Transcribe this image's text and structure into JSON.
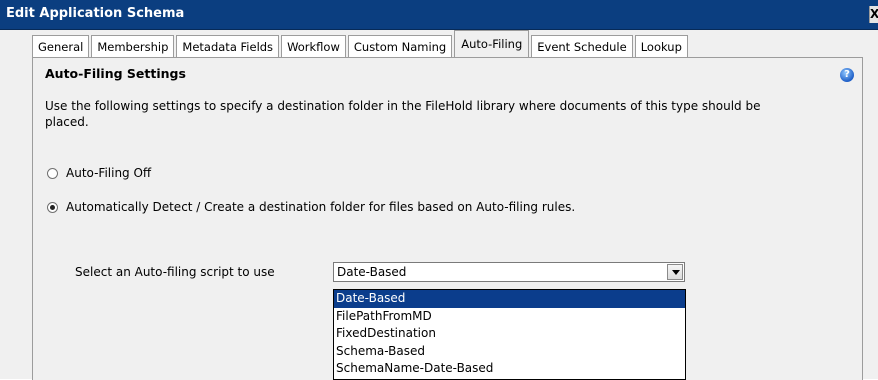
{
  "window": {
    "title": "Edit Application Schema",
    "close_label": "X"
  },
  "tabs": [
    {
      "label": "General",
      "active": false
    },
    {
      "label": "Membership",
      "active": false
    },
    {
      "label": "Metadata Fields",
      "active": false
    },
    {
      "label": "Workflow",
      "active": false
    },
    {
      "label": "Custom Naming",
      "active": false
    },
    {
      "label": "Auto-Filing",
      "active": true
    },
    {
      "label": "Event Schedule",
      "active": false
    },
    {
      "label": "Lookup",
      "active": false
    }
  ],
  "panel": {
    "title": "Auto-Filing Settings",
    "help_icon": "help-icon",
    "description": "Use the following settings to specify a destination folder in the FileHold library where documents of this type should be placed.",
    "options": [
      {
        "label": "Auto-Filing Off",
        "checked": false
      },
      {
        "label": "Automatically Detect / Create a destination folder for files based on Auto-filing rules.",
        "checked": true
      }
    ],
    "script_label": "Select an Auto-filing script to use",
    "script_select": {
      "value": "Date-Based",
      "options": [
        "Date-Based",
        "FilePathFromMD",
        "FixedDestination",
        "Schema-Based",
        "SchemaName-Date-Based"
      ],
      "highlighted": "Date-Based"
    }
  },
  "colors": {
    "title_bar": "#0b3e80",
    "selection": "#0b3d8c",
    "window_bg": "#f0f0f0"
  }
}
